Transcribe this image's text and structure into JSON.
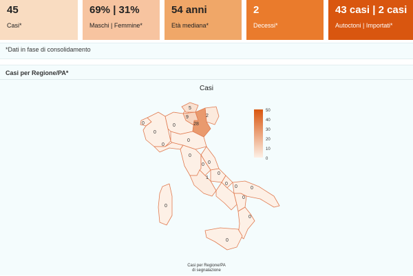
{
  "kpis": [
    {
      "value": "45",
      "label": "Casi*",
      "color": "#f9dcc1"
    },
    {
      "value": "69% | 31%",
      "label": "Maschi | Femmine*",
      "color": "#f7c4a0"
    },
    {
      "value": "54 anni",
      "label": "Età mediana*",
      "color": "#f0a768"
    },
    {
      "value": "2",
      "label": "Decessi*",
      "color": "#ea7b2c"
    },
    {
      "value": "43 casi | 2 casi",
      "label": "Autoctoni | Importati*",
      "color": "#d9560f"
    }
  ],
  "note": "*Dati in fase di consolidamento",
  "panel": {
    "title": "Casi per Regione/PA*",
    "chart_title": "Casi",
    "caption_line1": "Casi per Regione/PA",
    "caption_line2": "di segnalazione"
  },
  "legend": {
    "ticks": [
      "50",
      "40",
      "30",
      "20",
      "10",
      "0"
    ],
    "color_high": "#d9560f",
    "color_low": "#fdf0e6"
  },
  "chart_data": {
    "type": "choropleth",
    "title": "Casi",
    "colorbar_range": [
      0,
      50
    ],
    "region_values": [
      {
        "value": 0
      },
      {
        "value": 0
      },
      {
        "value": 0
      },
      {
        "value": 5
      },
      {
        "value": 9
      },
      {
        "value": 2
      },
      {
        "value": 28
      },
      {
        "value": 0
      },
      {
        "value": 0
      },
      {
        "value": 0
      },
      {
        "value": 0
      },
      {
        "value": 0
      },
      {
        "value": 1
      },
      {
        "value": 0
      },
      {
        "value": 0
      },
      {
        "value": 0
      },
      {
        "value": 0
      },
      {
        "value": 0
      },
      {
        "value": 0
      },
      {
        "value": 0
      },
      {
        "value": 0
      }
    ]
  }
}
